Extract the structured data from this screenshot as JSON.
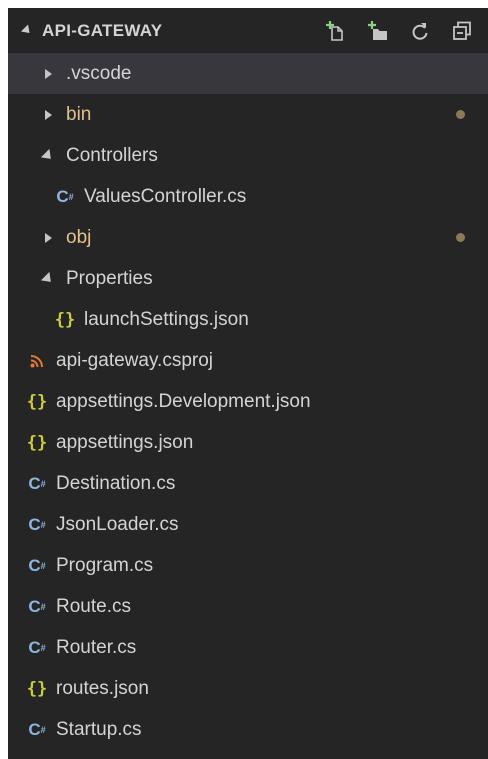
{
  "header": {
    "title": "API-GATEWAY",
    "actions": [
      {
        "name": "new-file-icon"
      },
      {
        "name": "new-folder-icon"
      },
      {
        "name": "refresh-icon"
      },
      {
        "name": "collapse-all-icon"
      }
    ]
  },
  "tree": [
    {
      "label": ".vscode",
      "type": "folder",
      "expanded": false
    },
    {
      "label": "bin",
      "type": "folder",
      "expanded": false,
      "modified": true
    },
    {
      "label": "Controllers",
      "type": "folder",
      "expanded": true
    },
    {
      "label": "ValuesController.cs",
      "type": "csharp-file"
    },
    {
      "label": "obj",
      "type": "folder",
      "expanded": false,
      "modified": true
    },
    {
      "label": "Properties",
      "type": "folder",
      "expanded": true
    },
    {
      "label": "launchSettings.json",
      "type": "json-file"
    },
    {
      "label": "api-gateway.csproj",
      "type": "csproj-file"
    },
    {
      "label": "appsettings.Development.json",
      "type": "json-file"
    },
    {
      "label": "appsettings.json",
      "type": "json-file"
    },
    {
      "label": "Destination.cs",
      "type": "csharp-file"
    },
    {
      "label": "JsonLoader.cs",
      "type": "csharp-file"
    },
    {
      "label": "Program.cs",
      "type": "csharp-file"
    },
    {
      "label": "Route.cs",
      "type": "csharp-file"
    },
    {
      "label": "Router.cs",
      "type": "csharp-file"
    },
    {
      "label": "routes.json",
      "type": "json-file"
    },
    {
      "label": "Startup.cs",
      "type": "csharp-file"
    }
  ],
  "colors": {
    "background": "#252526",
    "selected_row": "#37373d",
    "ignored_folder_text": "#e2c08d",
    "modified_dot": "#8b7a57",
    "json_icon": "#cbcb41",
    "csharp_icon": "#8fb4dd",
    "csproj_icon": "#e37933"
  }
}
